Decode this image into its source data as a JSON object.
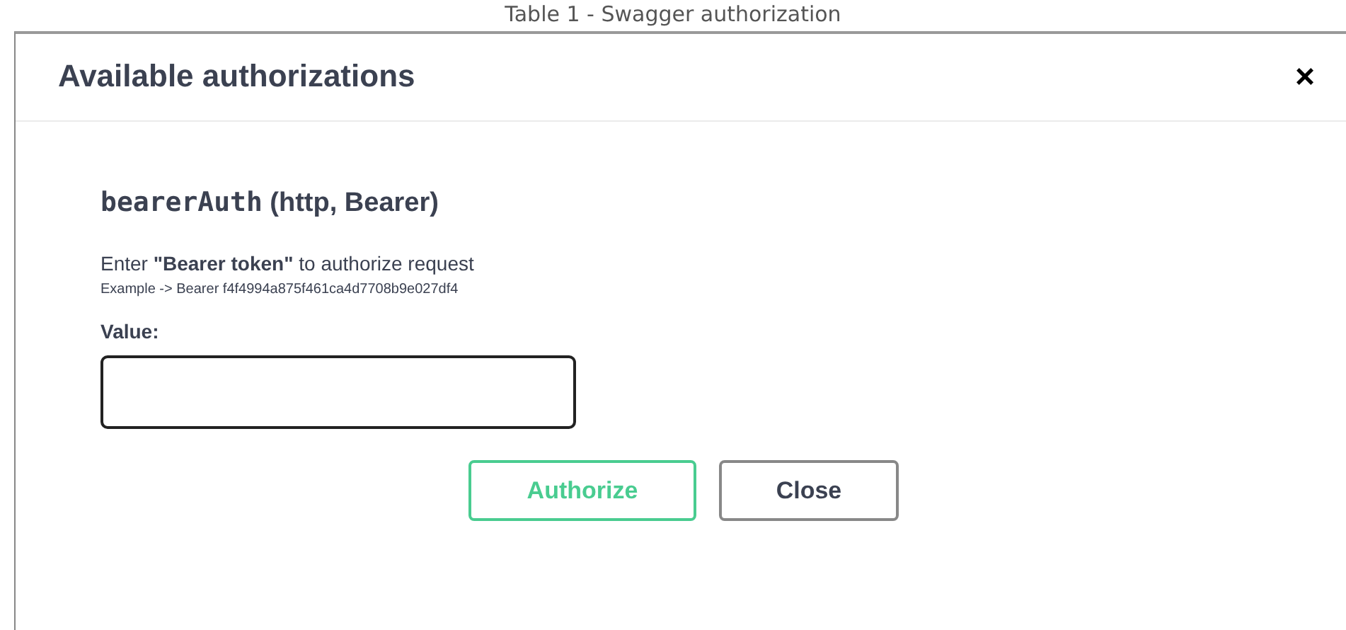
{
  "caption": "Table 1 - Swagger authorization",
  "dialog": {
    "title": "Available authorizations",
    "close_icon": "×"
  },
  "scheme": {
    "name": "bearerAuth",
    "details": "(http, Bearer)",
    "description": "Enter **\"Bearer token\"** to authorize request",
    "example": "Example -> Bearer f4f4994a875f461ca4d7708b9e027df4",
    "value_label": "Value:"
  },
  "buttons": [
    {
      "label": "Authorize",
      "kind": "primary"
    },
    {
      "label": "Close",
      "kind": "secondary"
    }
  ]
}
